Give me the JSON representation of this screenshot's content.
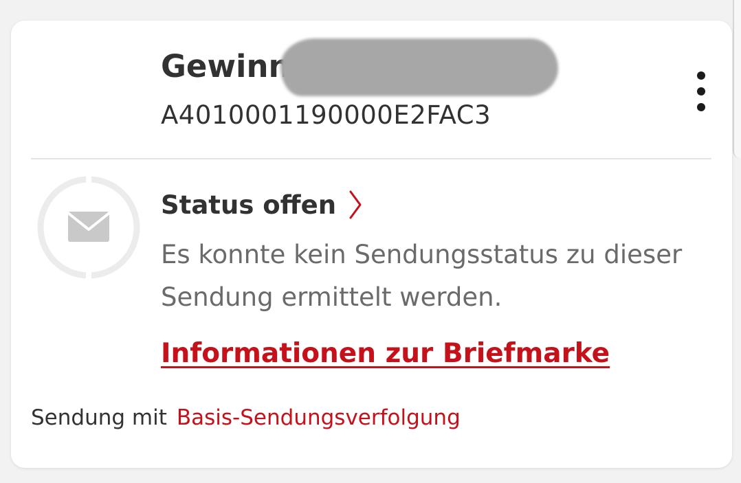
{
  "colors": {
    "accent": "#c4111a",
    "text_primary": "#323232",
    "text_secondary": "#6a6a6a",
    "redaction": "#a7a7a7",
    "status_ring": "#ececec",
    "envelope": "#c9c9c9"
  },
  "shipment": {
    "title": "Gewinn",
    "tracking_id": "A4010001190000E2FAC3",
    "menu_icon": "more-vertical-icon"
  },
  "status": {
    "icon": "envelope-icon",
    "title": "Status offen",
    "chevron_icon": "chevron-right-icon",
    "description": "Es konnte kein Sendungsstatus zu dieser Sendung ermittelt werden."
  },
  "info_link": {
    "label": "Informationen zur Briefmarke"
  },
  "footer": {
    "label": "Sendung mit",
    "link": "Basis-Sendungsverfolgung"
  }
}
